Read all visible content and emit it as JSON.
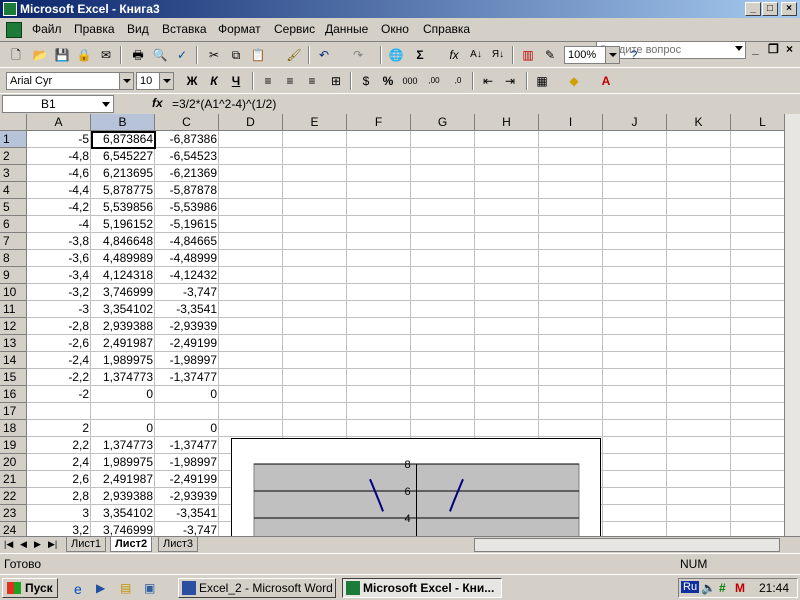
{
  "window": {
    "title": "Microsoft Excel - Книга3"
  },
  "menu": {
    "items": [
      "Файл",
      "Правка",
      "Вид",
      "Вставка",
      "Формат",
      "Сервис",
      "Данные",
      "Окно",
      "Справка"
    ],
    "ask_placeholder": "Введите вопрос"
  },
  "toolbar": {
    "zoom": "100%",
    "font": "Arial Cyr",
    "font_size": "10",
    "bold": "Ж",
    "italic": "К",
    "underline": "Ч"
  },
  "formula_bar": {
    "name_box": "B1",
    "fx": "fx",
    "formula": "=3/2*(A1^2-4)^(1/2)"
  },
  "columns": [
    "A",
    "B",
    "C",
    "D",
    "E",
    "F",
    "G",
    "H",
    "I",
    "J",
    "K",
    "L"
  ],
  "rows": [
    {
      "n": "1",
      "a": "-5",
      "b": "6,873864",
      "c": "-6,87386"
    },
    {
      "n": "2",
      "a": "-4,8",
      "b": "6,545227",
      "c": "-6,54523"
    },
    {
      "n": "3",
      "a": "-4,6",
      "b": "6,213695",
      "c": "-6,21369"
    },
    {
      "n": "4",
      "a": "-4,4",
      "b": "5,878775",
      "c": "-5,87878"
    },
    {
      "n": "5",
      "a": "-4,2",
      "b": "5,539856",
      "c": "-5,53986"
    },
    {
      "n": "6",
      "a": "-4",
      "b": "5,196152",
      "c": "-5,19615"
    },
    {
      "n": "7",
      "a": "-3,8",
      "b": "4,846648",
      "c": "-4,84665"
    },
    {
      "n": "8",
      "a": "-3,6",
      "b": "4,489989",
      "c": "-4,48999"
    },
    {
      "n": "9",
      "a": "-3,4",
      "b": "4,124318",
      "c": "-4,12432"
    },
    {
      "n": "10",
      "a": "-3,2",
      "b": "3,746999",
      "c": "-3,747"
    },
    {
      "n": "11",
      "a": "-3",
      "b": "3,354102",
      "c": "-3,3541"
    },
    {
      "n": "12",
      "a": "-2,8",
      "b": "2,939388",
      "c": "-2,93939"
    },
    {
      "n": "13",
      "a": "-2,6",
      "b": "2,491987",
      "c": "-2,49199"
    },
    {
      "n": "14",
      "a": "-2,4",
      "b": "1,989975",
      "c": "-1,98997"
    },
    {
      "n": "15",
      "a": "-2,2",
      "b": "1,374773",
      "c": "-1,37477"
    },
    {
      "n": "16",
      "a": "-2",
      "b": "0",
      "c": "0"
    },
    {
      "n": "17",
      "a": "",
      "b": "",
      "c": ""
    },
    {
      "n": "18",
      "a": "2",
      "b": "0",
      "c": "0"
    },
    {
      "n": "19",
      "a": "2,2",
      "b": "1,374773",
      "c": "-1,37477"
    },
    {
      "n": "20",
      "a": "2,4",
      "b": "1,989975",
      "c": "-1,98997"
    },
    {
      "n": "21",
      "a": "2,6",
      "b": "2,491987",
      "c": "-2,49199"
    },
    {
      "n": "22",
      "a": "2,8",
      "b": "2,939388",
      "c": "-2,93939"
    },
    {
      "n": "23",
      "a": "3",
      "b": "3,354102",
      "c": "-3,3541"
    },
    {
      "n": "24",
      "a": "3,2",
      "b": "3,746999",
      "c": "-3,747"
    }
  ],
  "chart_data": {
    "type": "line",
    "y_ticks": [
      "8",
      "6",
      "4"
    ],
    "ylim": [
      0,
      8
    ],
    "series": [
      {
        "x": [
          -5,
          -4.8,
          -4.6,
          -4.4,
          -4.2,
          -4,
          -3.8,
          -3.6
        ],
        "y": [
          6.87,
          6.55,
          6.21,
          5.88,
          5.54,
          5.2,
          4.85,
          4.49
        ]
      },
      {
        "x": [
          3.6,
          3.8,
          4,
          4.2,
          4.4,
          4.6,
          4.8,
          5
        ],
        "y": [
          4.49,
          4.85,
          5.2,
          5.54,
          5.88,
          6.21,
          6.55,
          6.87
        ]
      }
    ],
    "line_color": "#000080",
    "plot_color": "#c0c0c0"
  },
  "sheet_tabs": [
    "Лист1",
    "Лист2",
    "Лист3"
  ],
  "status": {
    "left": "Готово",
    "num": "NUM"
  },
  "taskbar": {
    "start": "Пуск",
    "tasks": [
      "Excel_2 - Microsoft Word",
      "Microsoft Excel - Кни..."
    ],
    "lang": "Ru",
    "time": "21:44"
  }
}
